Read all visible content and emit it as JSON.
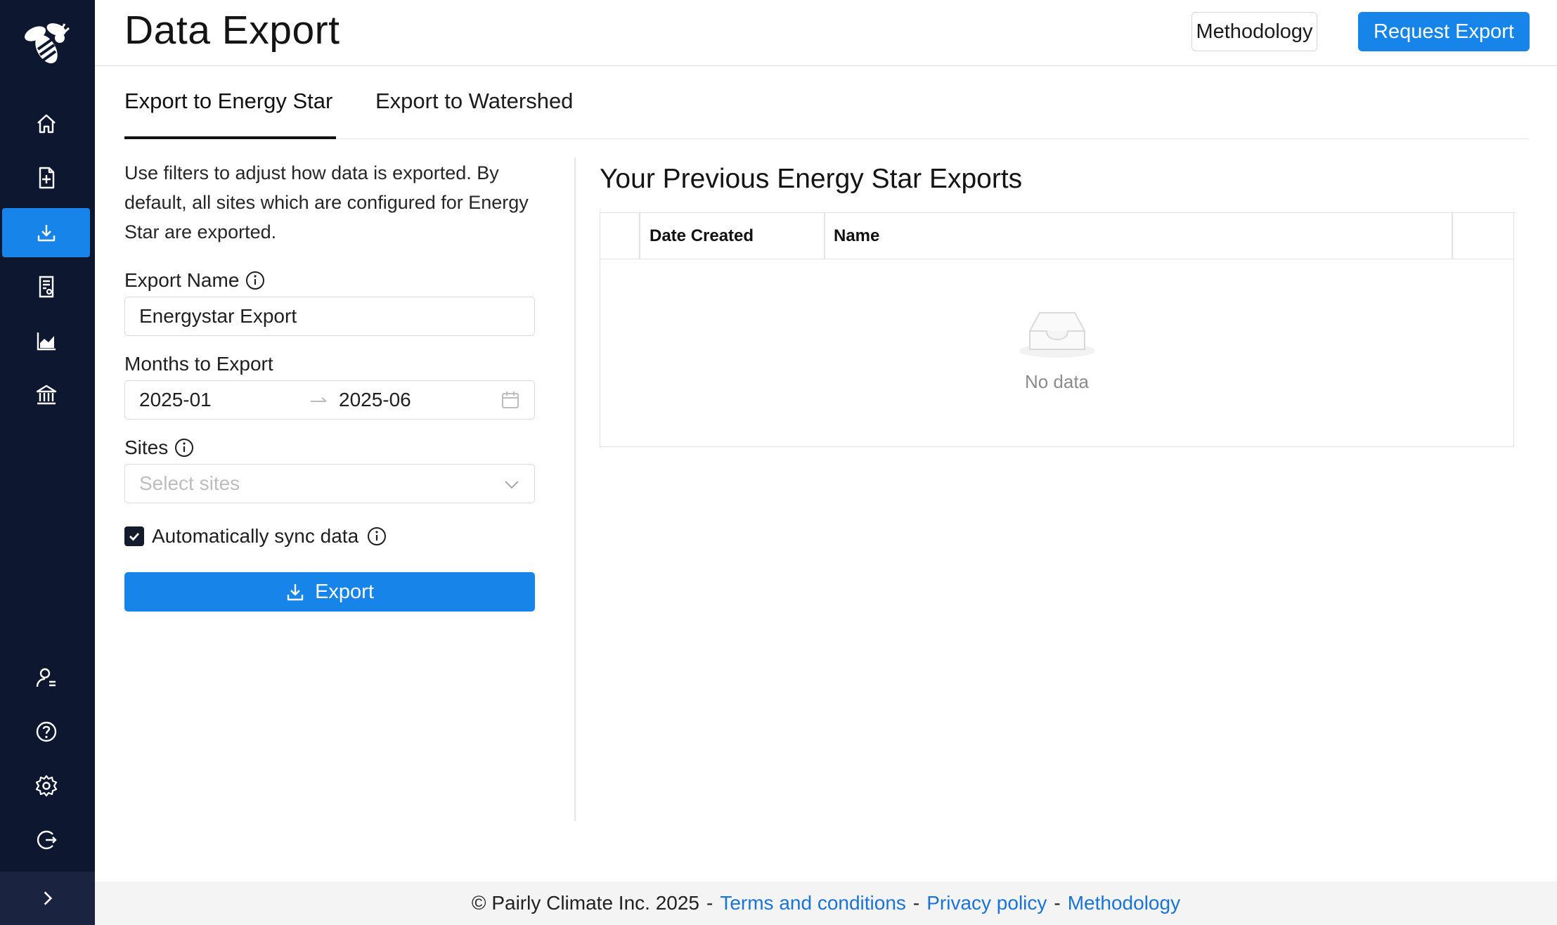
{
  "header": {
    "title": "Data Export",
    "methodology_label": "Methodology",
    "request_export_label": "Request Export"
  },
  "sidebar": {
    "items": [
      {
        "icon": "home-icon"
      },
      {
        "icon": "add-document-icon"
      },
      {
        "icon": "download-icon",
        "active": true
      },
      {
        "icon": "report-icon"
      },
      {
        "icon": "area-chart-icon"
      },
      {
        "icon": "bank-icon"
      },
      {
        "icon": "user-settings-icon"
      },
      {
        "icon": "help-icon"
      },
      {
        "icon": "gear-icon"
      },
      {
        "icon": "logout-icon"
      }
    ],
    "collapse_icon": "chevron-right-icon"
  },
  "tabs": [
    {
      "label": "Export to Energy Star",
      "active": true
    },
    {
      "label": "Export to Watershed",
      "active": false
    }
  ],
  "form": {
    "intro": "Use filters to adjust how data is exported. By default, all sites which are configured for Energy Star are exported.",
    "export_name_label": "Export Name",
    "export_name_value": "Energystar Export",
    "months_label": "Months to Export",
    "month_start": "2025-01",
    "month_end": "2025-06",
    "sites_label": "Sites",
    "sites_placeholder": "Select sites",
    "auto_sync_label": "Automatically sync data",
    "auto_sync_checked": true,
    "export_button": "Export"
  },
  "previous_exports": {
    "title": "Your Previous Energy Star Exports",
    "columns": [
      "Date Created",
      "Name"
    ],
    "rows": [],
    "empty_text": "No data"
  },
  "footer": {
    "copyright": "© Pairly Climate Inc. 2025",
    "terms": "Terms and conditions",
    "privacy": "Privacy policy",
    "methodology": "Methodology"
  },
  "colors": {
    "sidebar_bg": "#0d1730",
    "accent": "#1684e8",
    "link": "#1a73d6"
  }
}
